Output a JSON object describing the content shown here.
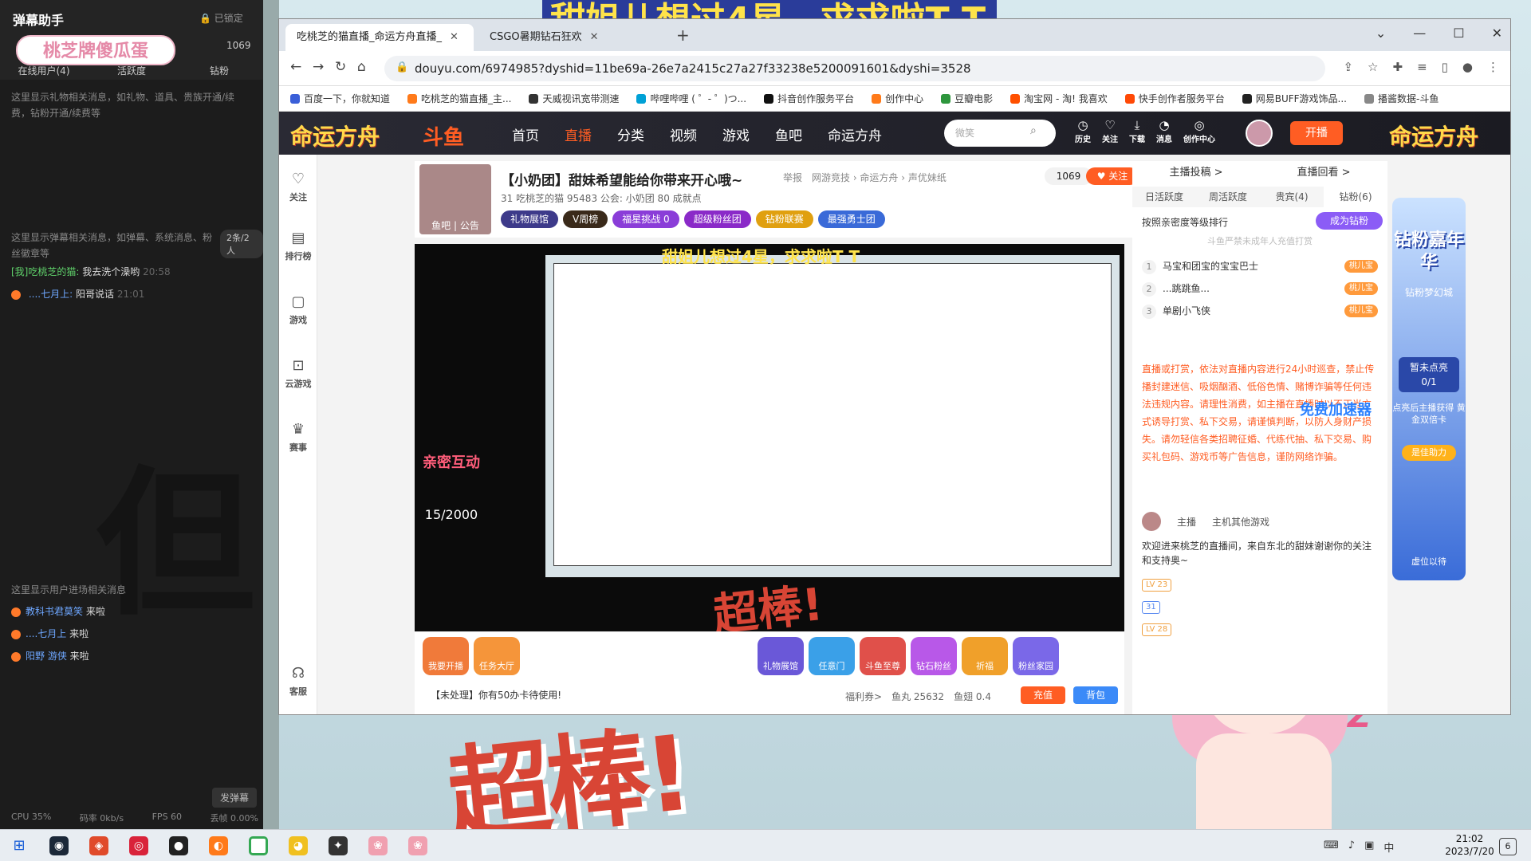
{
  "overlay": {
    "top_banner": "甜姐儿想过4星，求求啦T T",
    "chaobang": "超棒!"
  },
  "obs_panel": {
    "title": "弹幕助手",
    "brand": "桃芝牌傻瓜蛋",
    "lock_label": "已锁定",
    "count": "1069",
    "tabs": [
      "在线用户(4)",
      "活跃度",
      "钻粉"
    ],
    "gift_hint": "这里显示礼物相关消息，如礼物、道具、贵族开通/续费，钻粉开通/续费等",
    "danmu_hint": "这里显示弹幕相关消息，如弹幕、系统消息、粉丝徽章等",
    "badge": "2条/2人",
    "messages": [
      {
        "prefix": "[我]吃桃芝的猫:",
        "text": "我去洗个澡哟",
        "time": "20:58"
      },
      {
        "prefix": "....七月上:",
        "text": "阳哥说话",
        "time": "21:01"
      }
    ],
    "enter_hint": "这里显示用户进场相关消息",
    "enters": [
      {
        "name": "教科书君莫笑",
        "text": "来啦"
      },
      {
        "name": "....七月上",
        "text": "来啦"
      },
      {
        "name": "阳野 游侠",
        "text": "来啦"
      }
    ],
    "send_button": "发弹幕",
    "status": {
      "cpu": "CPU 35%",
      "bitrate": "码率 0kb/s",
      "fps": "FPS 60",
      "drop": "丢帧 0.00%"
    }
  },
  "browser": {
    "tabs": [
      {
        "title": "吃桃芝的猫直播_命运方舟直播_"
      },
      {
        "title": "CSGO暑期钻石狂欢"
      }
    ],
    "url": "douyu.com/6974985?dyshid=11be69a-26e7a2415c27a27f33238e5200091601&dyshi=3528",
    "bookmarks": [
      "百度一下，你就知道",
      "吃桃芝的猫直播_主...",
      "天威视讯宽带测速",
      "哔哩哔哩 ( ゜- ゜)つ...",
      "抖音创作服务平台",
      "创作中心",
      "豆瓣电影",
      "淘宝网 - 淘! 我喜欢",
      "快手创作者服务平台",
      "网易BUFF游戏饰品...",
      "播酱数据-斗鱼"
    ]
  },
  "site": {
    "side_logo": "命运方舟",
    "logo": "斗鱼",
    "nav": [
      "首页",
      "直播",
      "分类",
      "视频",
      "游戏",
      "鱼吧",
      "命运方舟"
    ],
    "search_placeholder": "微笑",
    "header_icons": [
      "历史",
      "关注",
      "下载",
      "消息",
      "创作中心"
    ],
    "kaibo": "开播",
    "rail": [
      "关注",
      "排行榜",
      "游戏",
      "云游戏",
      "赛事",
      "客服"
    ]
  },
  "room": {
    "cover_label": "鱼吧 | 公告",
    "title": "【小奶团】甜妹希望能给你带来开心哦~",
    "report": "举报",
    "category": "网游竞技 › 命运方舟 › 声优妹纸",
    "meta": "31 吃桃芝的猫  95483  公会: 小奶团  80 成就点",
    "follow_count": "1069",
    "follow": "关注",
    "badges": [
      "礼物展馆",
      "V周榜",
      "福星挑战 0",
      "超级粉丝团",
      "钻粉联赛",
      "最强勇士团"
    ]
  },
  "video": {
    "caption": "甜姐儿想过4星，求求啦T T",
    "qinmi_title": "亲密互动",
    "qinmi_value": "15/2000"
  },
  "gift_bar": {
    "gifts": [
      "我要开播",
      "任务大厅",
      "礼物展馆",
      "任意门",
      "斗鱼至尊",
      "钻石粉丝",
      "祈福",
      "粉丝家园"
    ],
    "pending": "【未处理】你有50办卡待使用!",
    "wallet": [
      "福利券>",
      "鱼丸 25632",
      "鱼翅 0.4"
    ],
    "recharge": "充值",
    "backpack": "背包"
  },
  "right": {
    "top": [
      "主播投稿 >",
      "直播回看 >"
    ],
    "tabs": [
      "日活跃度",
      "周活跃度",
      "贵宾(4)",
      "钻粉(6)"
    ],
    "rank_title": "按照亲密度等级排行",
    "diamond_button": "成为钻粉",
    "notice": "斗鱼严禁未成年人充值打赏",
    "ranks": [
      {
        "n": "1",
        "name": "马宝和团宝的宝宝巴士",
        "tag": "桃儿宝"
      },
      {
        "n": "2",
        "name": "...跳跳鱼...",
        "tag": "桃儿宝"
      },
      {
        "n": "3",
        "name": "单剧小飞侠",
        "tag": "桃儿宝"
      }
    ],
    "warning": "直播或打赏，依法对直播内容进行24小时巡查，禁止传播封建迷信、吸烟酗酒、低俗色情、赌博诈骗等任何违法违规内容。请理性消费，如主播在直播时以不正当方式诱导打赏、私下交易，请谨慎判断，以防人身财产损失。请勿轻信各类招聘征婚、代练代抽、私下交易、购买礼包码、游戏币等广告信息，谨防网络诈骗。",
    "anchor_label": "主播",
    "anchor_other": "主机其他游戏",
    "welcome": "欢迎进来桃芝的直播间，来自东北的甜妹谢谢你的关注和支持奥~",
    "levels": [
      "LV 23",
      "31",
      "LV 28"
    ],
    "speed": "免费加速器"
  },
  "promo": {
    "title": "钻粉嘉年华",
    "sub": "钻粉梦幻城",
    "box_line1": "暂未点亮",
    "box_line2": "0/1",
    "hint": "点亮后主播获得 黄金双倍卡",
    "help": "是佳助力",
    "wait": "虚位以待"
  },
  "taskbar": {
    "time": "21:02",
    "date": "2023/7/20",
    "notify_count": "6"
  }
}
